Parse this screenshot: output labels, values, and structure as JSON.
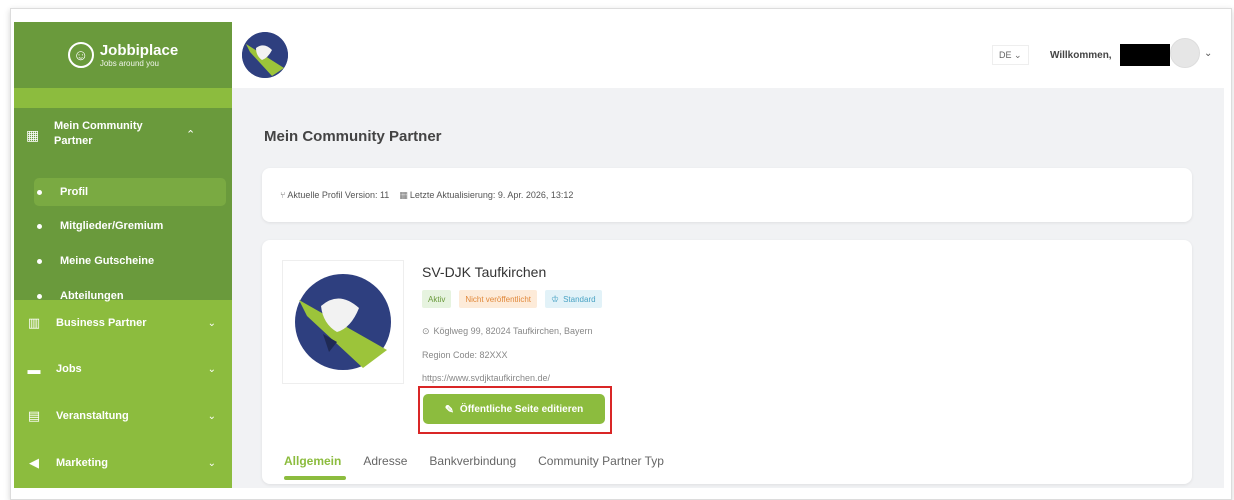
{
  "brand": {
    "title": "Jobbiplace",
    "subtitle": "Jobs around you"
  },
  "header": {
    "language": "DE ⌄",
    "welcome": "Willkommen,"
  },
  "sidebar": {
    "active_group": {
      "label": "Mein Community Partner",
      "items": [
        "Profil",
        "Mitglieder/Gremium",
        "Meine Gutscheine",
        "Abteilungen"
      ]
    },
    "groups": [
      {
        "label": "Business Partner",
        "icon": "building-icon"
      },
      {
        "label": "Jobs",
        "icon": "briefcase-icon"
      },
      {
        "label": "Veranstaltung",
        "icon": "calendar-icon"
      },
      {
        "label": "Marketing",
        "icon": "megaphone-icon"
      }
    ]
  },
  "page": {
    "title": "Mein Community Partner",
    "version": "Aktuelle Profil Version: 11",
    "last_update": "Letzte Aktualisierung: 9. Apr. 2026, 13:12"
  },
  "profile": {
    "name": "SV-DJK Taufkirchen",
    "badges": {
      "active": "Aktiv",
      "unpublished": "Nicht veröffentlicht",
      "standard": "Standard"
    },
    "address": "Köglweg 99, 82024 Taufkirchen, Bayern",
    "region": "Region Code: 82XXX",
    "url": "https://www.svdjktaufkirchen.de/",
    "edit_button": "Öffentliche Seite editieren"
  },
  "tabs": [
    "Allgemein",
    "Adresse",
    "Bankverbindung",
    "Community Partner Typ"
  ],
  "colors": {
    "primary_green": "#8cbc3e",
    "dark_green": "#6a9a3c",
    "highlight_red": "#d92626"
  }
}
